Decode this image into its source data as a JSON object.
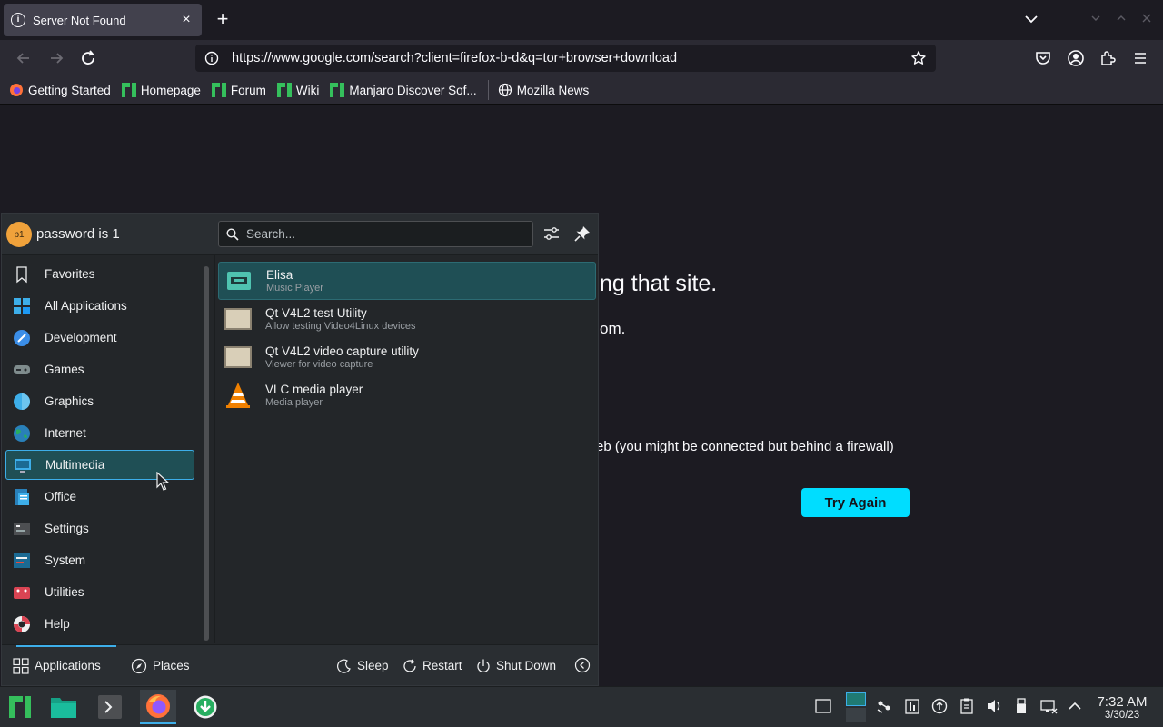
{
  "browser": {
    "tab_title": "Server Not Found",
    "tab_close": "×",
    "new_tab": "+",
    "url": "https://www.google.com/search?client=firefox-b-d&q=tor+browser+download",
    "bookmarks": [
      {
        "label": "Getting Started",
        "icon": "firefox-icon"
      },
      {
        "label": "Homepage",
        "icon": "manjaro-icon"
      },
      {
        "label": "Forum",
        "icon": "manjaro-icon"
      },
      {
        "label": "Wiki",
        "icon": "manjaro-icon"
      },
      {
        "label": "Manjaro Discover Sof...",
        "icon": "manjaro-icon"
      },
      {
        "label": "Mozilla News",
        "icon": "globe-icon"
      }
    ]
  },
  "page": {
    "heading_fragment": "ng that site.",
    "line1_fragment": "om.",
    "line2_fragment": "eb (you might be connected but behind a firewall)",
    "try_again": "Try Again"
  },
  "launcher": {
    "avatar_text": "p1",
    "username": "password is 1",
    "search_placeholder": "Search...",
    "categories": [
      {
        "label": "Favorites",
        "icon": "bookmark-icon"
      },
      {
        "label": "All Applications",
        "icon": "grid-icon"
      },
      {
        "label": "Development",
        "icon": "development-icon"
      },
      {
        "label": "Games",
        "icon": "gamepad-icon"
      },
      {
        "label": "Graphics",
        "icon": "graphics-icon"
      },
      {
        "label": "Internet",
        "icon": "internet-globe-icon"
      },
      {
        "label": "Multimedia",
        "icon": "multimedia-icon"
      },
      {
        "label": "Office",
        "icon": "office-icon"
      },
      {
        "label": "Settings",
        "icon": "settings-icon"
      },
      {
        "label": "System",
        "icon": "system-icon"
      },
      {
        "label": "Utilities",
        "icon": "utilities-icon"
      },
      {
        "label": "Help",
        "icon": "help-icon"
      }
    ],
    "active_category": "Multimedia",
    "apps": [
      {
        "name": "Elisa",
        "desc": "Music Player",
        "icon": "elisa-icon"
      },
      {
        "name": "Qt V4L2 test Utility",
        "desc": "Allow testing Video4Linux devices",
        "icon": "qv4l2-icon"
      },
      {
        "name": "Qt V4L2 video capture utility",
        "desc": "Viewer for video capture",
        "icon": "qvidcap-icon"
      },
      {
        "name": "VLC media player",
        "desc": "Media player",
        "icon": "vlc-icon"
      }
    ],
    "footer": {
      "applications": "Applications",
      "places": "Places",
      "sleep": "Sleep",
      "restart": "Restart",
      "shutdown": "Shut Down"
    }
  },
  "taskbar": {
    "time": "7:32 AM",
    "date": "3/30/23"
  },
  "colors": {
    "accent": "#3daee9",
    "try_again_bg": "#00ddff",
    "selection_bg": "#1f4f55"
  }
}
